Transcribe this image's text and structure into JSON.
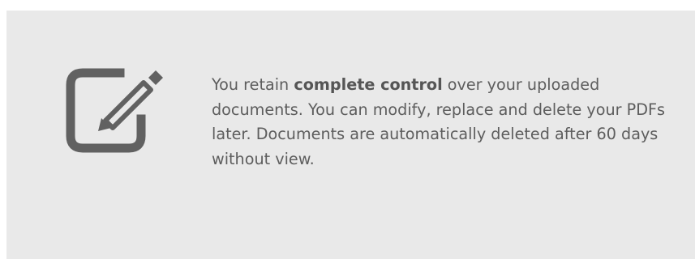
{
  "feature": {
    "icon": "edit-document-icon",
    "text_before_bold": "You retain ",
    "text_bold": "complete control",
    "text_after_bold": " over your uploaded documents. You can modify, replace and delete your PDFs later. Documents are automatically deleted after 60 days without view.",
    "text_color": "#5d5d5d",
    "icon_color": "#616161",
    "background_color": "#e9e9e9"
  }
}
